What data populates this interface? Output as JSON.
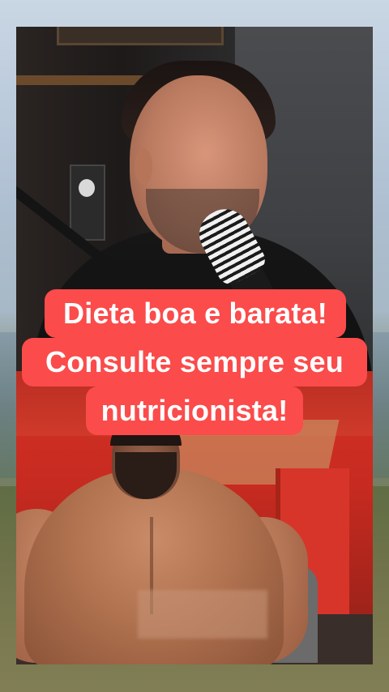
{
  "caption": {
    "line1": "Dieta boa e barata!",
    "line2": "Consulte sempre seu",
    "line3": "nutricionista!"
  },
  "colors": {
    "caption_background": "#fb4b4b",
    "caption_text": "#ffffff"
  }
}
